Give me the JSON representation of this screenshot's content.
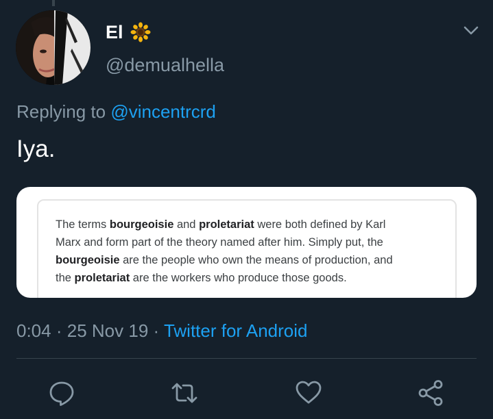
{
  "tweet": {
    "display_name": "El",
    "name_emoji": "sunflower",
    "handle": "@demualhella",
    "replying_prefix": "Replying to",
    "replying_to": "@vincentrcrd",
    "text": "Iya.",
    "media": {
      "lines": [
        [
          {
            "t": "The terms ",
            "b": false
          },
          {
            "t": "bourgeoisie",
            "b": true
          },
          {
            "t": " and ",
            "b": false
          },
          {
            "t": "proletariat",
            "b": true
          },
          {
            "t": " were both defined by Karl",
            "b": false
          }
        ],
        [
          {
            "t": "Marx and form part of the theory named after him. Simply put, the",
            "b": false
          }
        ],
        [
          {
            "t": "bourgeoisie",
            "b": true
          },
          {
            "t": " are the people who own the means of production, and",
            "b": false
          }
        ],
        [
          {
            "t": "the ",
            "b": false
          },
          {
            "t": "proletariat",
            "b": true
          },
          {
            "t": " are the workers who produce those goods.",
            "b": false
          }
        ]
      ]
    },
    "time": "0:04",
    "separator": "·",
    "date": "25 Nov 19",
    "source": "Twitter for Android"
  },
  "icons": {
    "caret": "chevron-down-icon",
    "reply": "reply-icon",
    "retweet": "retweet-icon",
    "like": "heart-icon",
    "share": "share-icon"
  },
  "colors": {
    "background": "#15202b",
    "accent": "#1da1f2",
    "secondary_text": "#8899a6",
    "primary_text": "#ffffff",
    "divider": "#38444d"
  }
}
